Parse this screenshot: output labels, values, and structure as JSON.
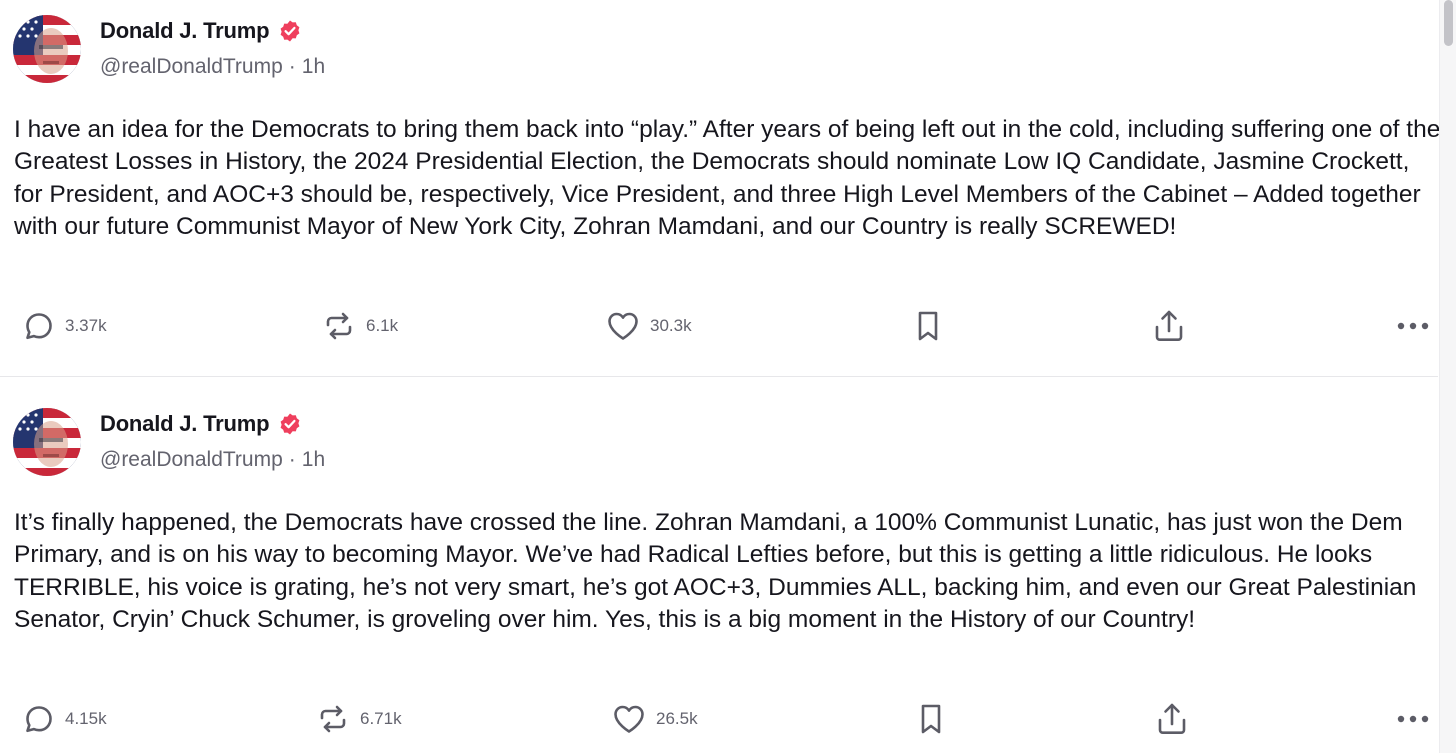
{
  "posts": [
    {
      "display_name": "Donald J. Trump",
      "handle": "@realDonaldTrump",
      "separator": "·",
      "time": "1h",
      "text": "I have an idea for the Democrats to bring them back into “play.” After years of being left out in the cold, including suffering one of the Greatest Losses in History, the 2024 Presidential Election, the Democrats should nominate Low IQ Candidate, Jasmine Crockett, for President, and AOC+3 should be, respectively, Vice President, and three High Level Members of the Cabinet – Added together with our future Communist Mayor of New York City, Zohran Mamdani, and our Country is really SCREWED!",
      "replies": "3.37k",
      "reposts": "6.1k",
      "likes": "30.3k"
    },
    {
      "display_name": "Donald J. Trump",
      "handle": "@realDonaldTrump",
      "separator": "·",
      "time": "1h",
      "text": "It’s finally happened, the Democrats have crossed the line. Zohran Mamdani, a 100% Communist Lunatic, has just won the Dem Primary, and is on his way to becoming Mayor. We’ve had Radical Lefties before, but this is getting a little ridiculous. He looks TERRIBLE, his voice is grating, he’s not very smart, he’s got AOC+3, Dummies ALL, backing him, and even our Great Palestinian Senator, Cryin’ Chuck Schumer, is groveling over him. Yes, this is a big moment in the History of our Country!",
      "replies": "4.15k",
      "reposts": "6.71k",
      "likes": "26.5k"
    }
  ],
  "icons": {
    "verified": "verified-badge-icon",
    "reply": "reply-bubble-icon",
    "repost": "repost-arrows-icon",
    "like": "heart-icon",
    "bookmark": "bookmark-icon",
    "share": "share-upload-icon",
    "more": "more-dots-icon"
  },
  "colors": {
    "verified_badge": "#ef3f5d",
    "text": "#16161d",
    "muted": "#63636e",
    "divider": "#e7e7ea"
  }
}
